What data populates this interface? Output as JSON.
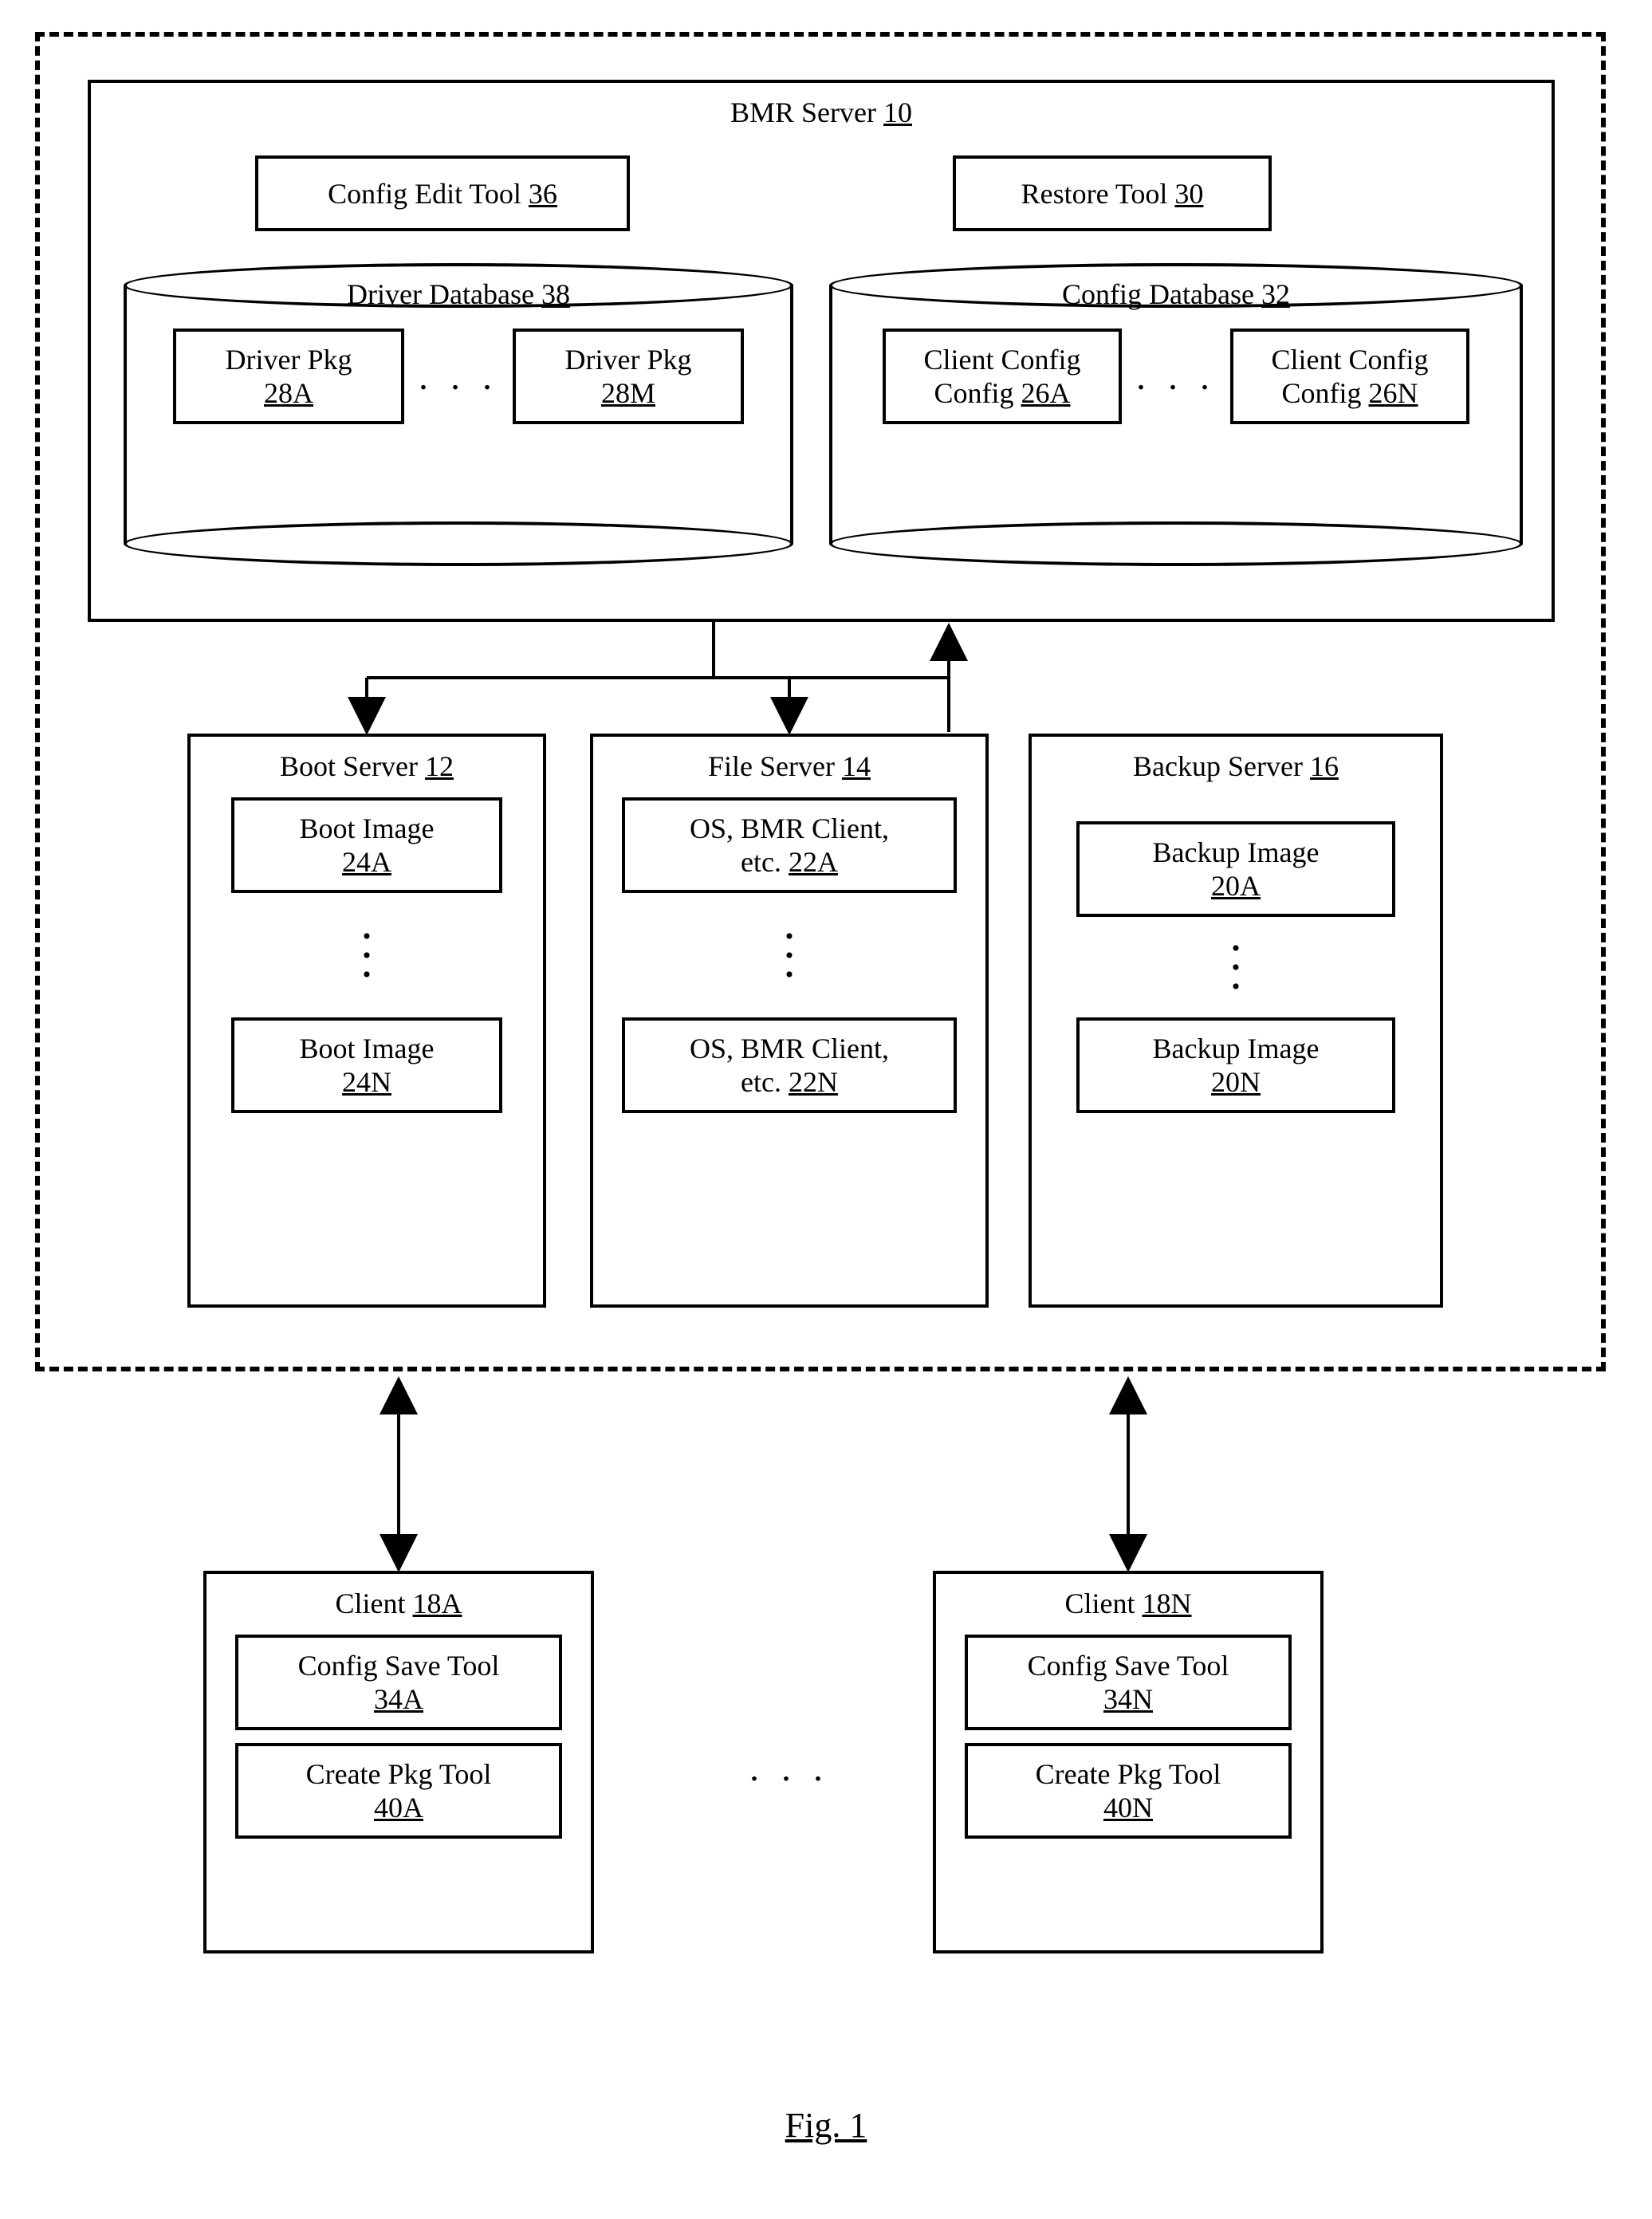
{
  "bmrServer": {
    "title": "BMR Server",
    "ref": "10",
    "configEditTool": {
      "label": "Config Edit Tool",
      "ref": "36"
    },
    "restoreTool": {
      "label": "Restore Tool",
      "ref": "30"
    },
    "driverDb": {
      "title": "Driver Database",
      "ref": "38",
      "items": [
        {
          "label": "Driver Pkg",
          "ref": "28A"
        },
        {
          "label": "Driver Pkg",
          "ref": "28M"
        }
      ]
    },
    "configDb": {
      "title": "Config Database",
      "ref": "32",
      "items": [
        {
          "label": "Client Config",
          "ref": "26A"
        },
        {
          "label": "Client Config",
          "ref": "26N"
        }
      ]
    }
  },
  "bootServer": {
    "title": "Boot Server",
    "ref": "12",
    "items": [
      {
        "label": "Boot Image",
        "ref": "24A"
      },
      {
        "label": "Boot Image",
        "ref": "24N"
      }
    ]
  },
  "fileServer": {
    "title": "File Server",
    "ref": "14",
    "items": [
      {
        "line1": "OS, BMR Client,",
        "line2": "etc.",
        "ref": "22A"
      },
      {
        "line1": "OS, BMR Client,",
        "line2": "etc.",
        "ref": "22N"
      }
    ]
  },
  "backupServer": {
    "title": "Backup Server",
    "ref": "16",
    "items": [
      {
        "label": "Backup Image",
        "ref": "20A"
      },
      {
        "label": "Backup Image",
        "ref": "20N"
      }
    ]
  },
  "clients": [
    {
      "title": "Client",
      "ref": "18A",
      "save": {
        "label": "Config Save Tool",
        "ref": "34A"
      },
      "pkg": {
        "label": "Create Pkg Tool",
        "ref": "40A"
      }
    },
    {
      "title": "Client",
      "ref": "18N",
      "save": {
        "label": "Config Save Tool",
        "ref": "34N"
      },
      "pkg": {
        "label": "Create Pkg Tool",
        "ref": "40N"
      }
    }
  ],
  "figureCaption": "Fig. 1",
  "ellipsis": ". . ."
}
